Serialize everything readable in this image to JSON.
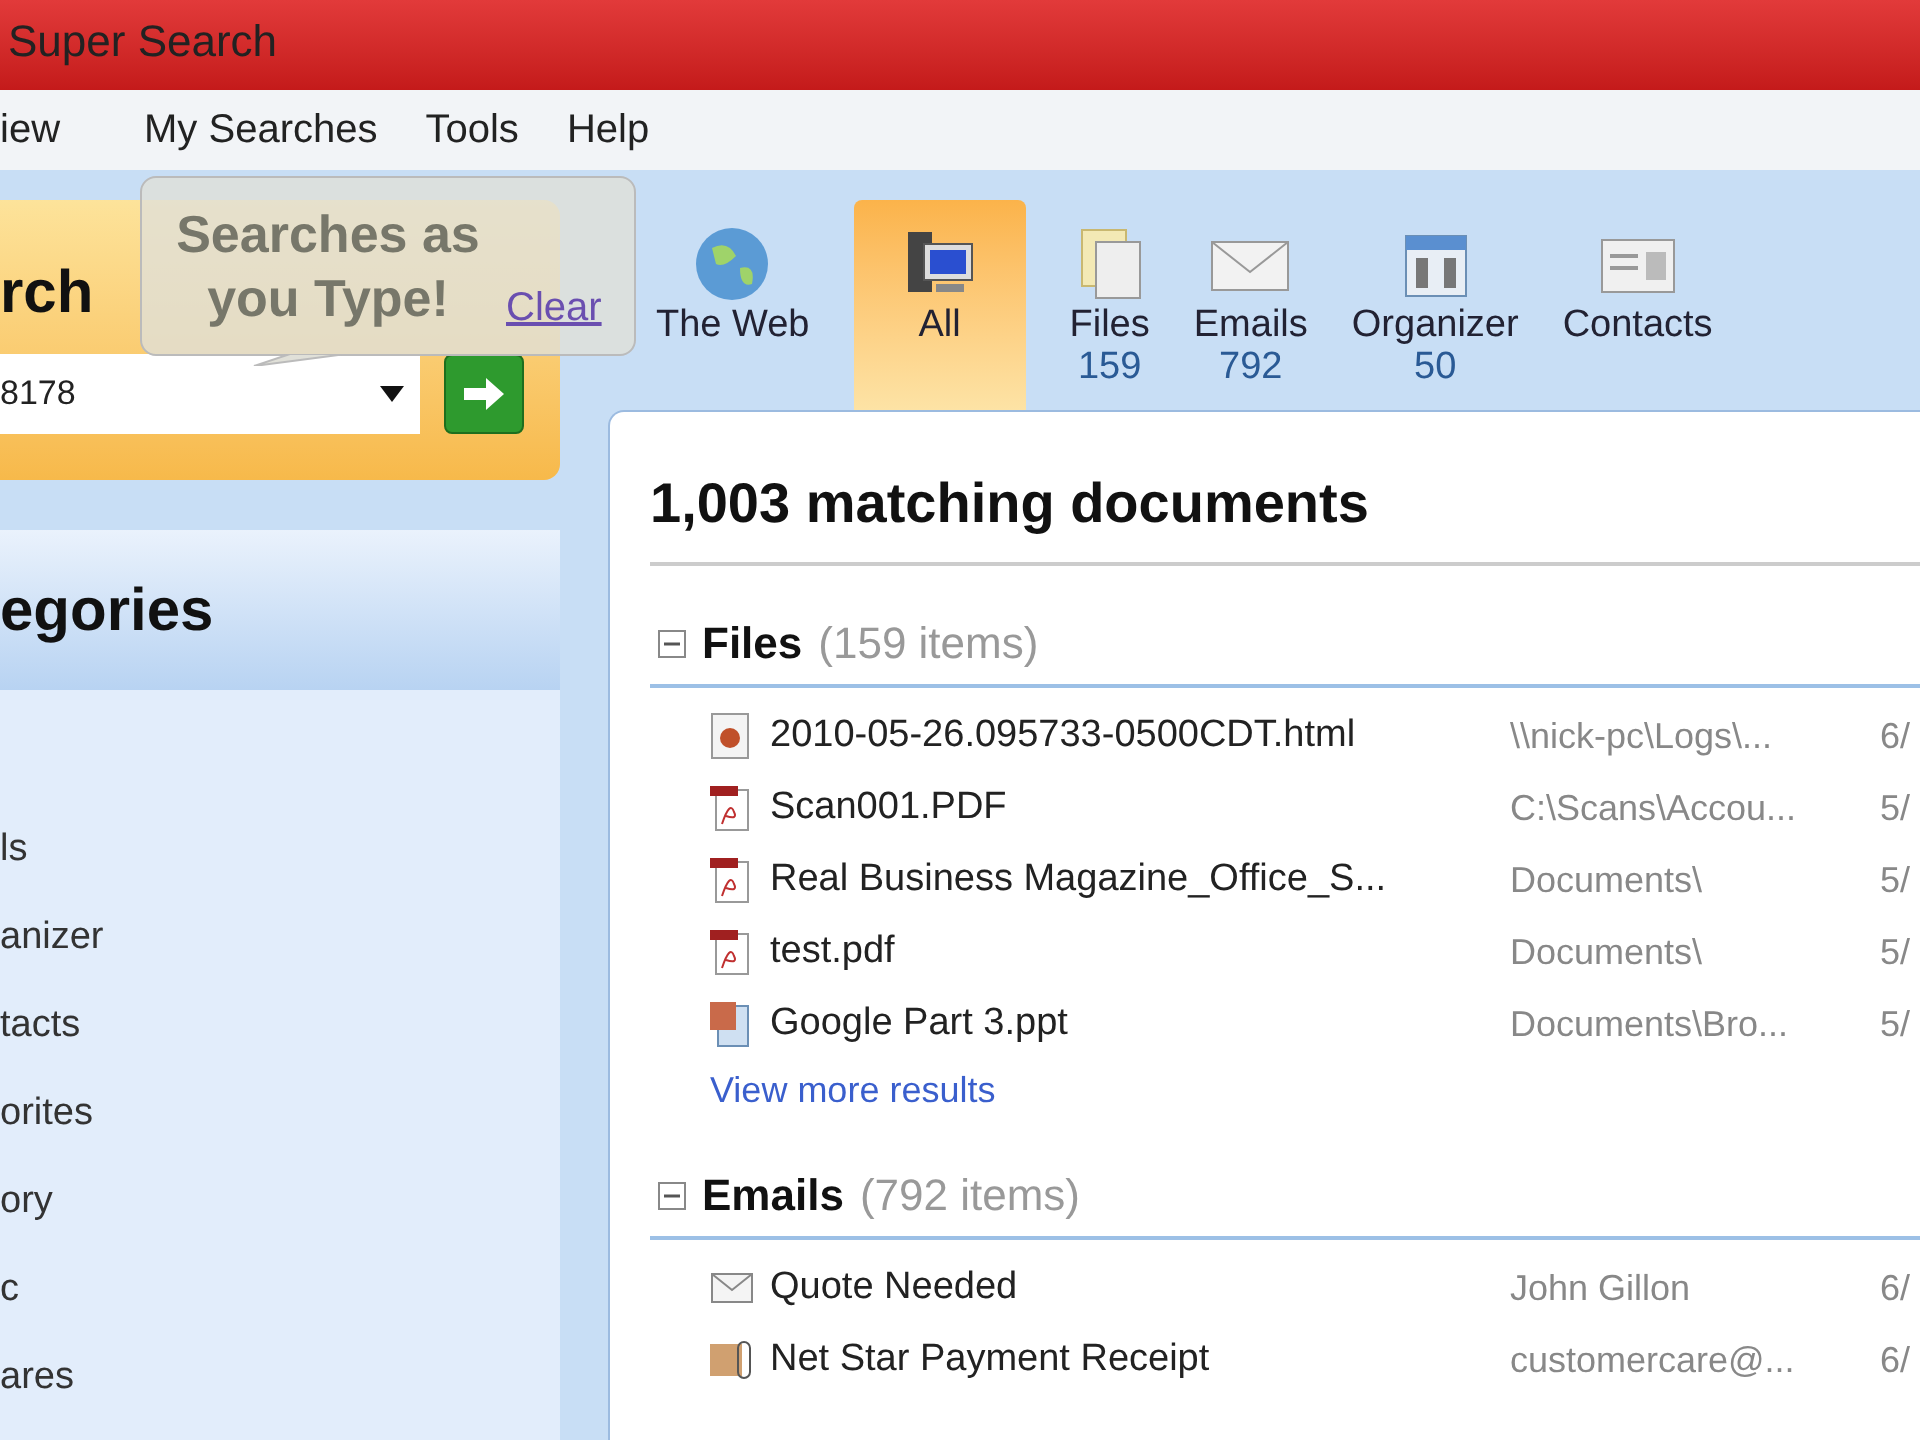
{
  "window": {
    "title": "Super Search"
  },
  "menu": [
    "iew",
    "My Searches",
    "Tools",
    "Help"
  ],
  "search": {
    "heading": "rch",
    "value": "8178"
  },
  "tooltip": {
    "text": "Searches as you Type!",
    "link": "Clear"
  },
  "tabs": [
    {
      "label": "The Web",
      "kind": "web",
      "selected": false
    },
    {
      "label": "All",
      "kind": "all",
      "selected": true
    },
    {
      "label": "Files",
      "count": "159",
      "kind": "files",
      "selected": false
    },
    {
      "label": "Emails",
      "count": "792",
      "kind": "emails",
      "selected": false
    },
    {
      "label": "Organizer",
      "count": "50",
      "kind": "organizer",
      "selected": false
    },
    {
      "label": "Contacts",
      "kind": "contacts",
      "selected": false
    }
  ],
  "sidebar": {
    "title": "egories",
    "items": [
      "ls",
      "anizer",
      "tacts",
      "orites",
      "ory",
      "c",
      "ares"
    ]
  },
  "results": {
    "heading": "1,003 matching documents",
    "groups": [
      {
        "title": "Files",
        "count": "(159 items)",
        "expanded": true,
        "rows": [
          {
            "kind": "html",
            "name": "2010-05-26.095733-0500CDT.html",
            "location": "\\\\nick-pc\\Logs\\...",
            "date": "6/"
          },
          {
            "kind": "pdf",
            "name": "Scan001.PDF",
            "location": "C:\\Scans\\Accou...",
            "date": "5/"
          },
          {
            "kind": "pdf",
            "name": "Real Business Magazine_Office_S...",
            "location": "Documents\\",
            "date": "5/"
          },
          {
            "kind": "pdf",
            "name": "test.pdf",
            "location": "Documents\\",
            "date": "5/"
          },
          {
            "kind": "ppt",
            "name": "Google Part 3.ppt",
            "location": "Documents\\Bro...",
            "date": "5/"
          }
        ],
        "more": "View more results"
      },
      {
        "title": "Emails",
        "count": "(792 items)",
        "expanded": true,
        "rows": [
          {
            "kind": "mail",
            "name": "Quote Needed",
            "location": "John Gillon",
            "date": "6/"
          },
          {
            "kind": "attach",
            "name": "Net Star Payment Receipt",
            "location": "customercare@...",
            "date": "6/"
          }
        ]
      }
    ]
  }
}
